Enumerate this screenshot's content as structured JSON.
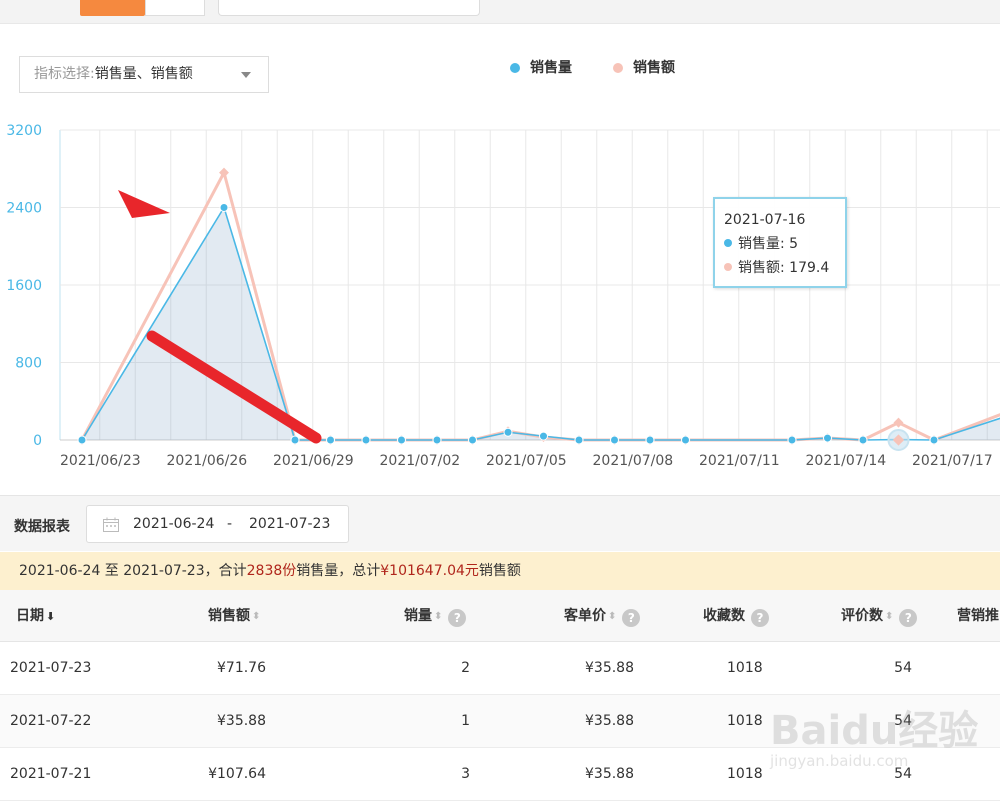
{
  "top_tabs": [
    "",
    ""
  ],
  "metric_select": {
    "label": "指标选择:",
    "value": "销售量、销售额"
  },
  "legend": [
    {
      "name": "销售量",
      "color": "#4ab8e6"
    },
    {
      "name": "销售额",
      "color": "#f7c3b8"
    }
  ],
  "chart_data": {
    "type": "area",
    "x": [
      "2021/06/23",
      "2021/06/24",
      "2021/06/25",
      "2021/06/26",
      "2021/06/27",
      "2021/06/28",
      "2021/06/29",
      "2021/06/30",
      "2021/07/01",
      "2021/07/02",
      "2021/07/03",
      "2021/07/04",
      "2021/07/05",
      "2021/07/06",
      "2021/07/07",
      "2021/07/08",
      "2021/07/09",
      "2021/07/10",
      "2021/07/11",
      "2021/07/12",
      "2021/07/13",
      "2021/07/14",
      "2021/07/15",
      "2021/07/16",
      "2021/07/17",
      "2021/07/18",
      "2021/07/19",
      "2021/07/20"
    ],
    "x_tick_labels": [
      "2021/06/23",
      "2021/06/26",
      "2021/06/29",
      "2021/07/02",
      "2021/07/05",
      "2021/07/08",
      "2021/07/11",
      "2021/07/14",
      "2021/07/17",
      "202"
    ],
    "series": [
      {
        "name": "销售量",
        "color": "#4ab8e6",
        "values": [
          0,
          null,
          null,
          null,
          2400,
          null,
          0,
          0,
          0,
          0,
          0,
          0,
          80,
          40,
          0,
          0,
          0,
          0,
          null,
          null,
          0,
          20,
          0,
          5,
          0,
          null,
          240,
          60
        ]
      },
      {
        "name": "销售额",
        "color": "#f7c3b8",
        "values": [
          0,
          null,
          null,
          null,
          2760,
          null,
          0,
          0,
          0,
          0,
          0,
          0,
          90,
          30,
          0,
          0,
          0,
          0,
          null,
          null,
          0,
          20,
          0,
          179.4,
          0,
          null,
          280,
          80
        ]
      }
    ],
    "y_ticks": [
      0,
      800,
      1600,
      2400,
      3200
    ],
    "ylim": [
      0,
      3200
    ],
    "grid": true,
    "legend_position": "top-center",
    "highlight_date": "2021/07/16"
  },
  "tooltip": {
    "date": "2021-07-16",
    "items": [
      {
        "name": "销售量",
        "value": "5",
        "color": "#4ab8e6"
      },
      {
        "name": "销售额",
        "value": "179.4",
        "color": "#f7c3b8"
      }
    ]
  },
  "report": {
    "title": "数据报表",
    "date_start": "2021-06-24",
    "date_sep": "-",
    "date_end": "2021-07-23"
  },
  "summary": {
    "prefix": "2021-06-24 至 2021-07-23，合计",
    "qty": "2838份",
    "mid": "销售量，总计",
    "amount": "¥101647.04元",
    "suffix": "销售额"
  },
  "table": {
    "columns": [
      "日期",
      "销售额",
      "销量",
      "客单价",
      "收藏数",
      "评价数",
      "营销推"
    ],
    "rows": [
      {
        "date": "2021-07-23",
        "sales": "¥71.76",
        "qty": "2",
        "unit_price": "¥35.88",
        "favorites": "1018",
        "reviews": "54"
      },
      {
        "date": "2021-07-22",
        "sales": "¥35.88",
        "qty": "1",
        "unit_price": "¥35.88",
        "favorites": "1018",
        "reviews": "54"
      },
      {
        "date": "2021-07-21",
        "sales": "¥107.64",
        "qty": "3",
        "unit_price": "¥35.88",
        "favorites": "1018",
        "reviews": "54"
      }
    ]
  },
  "watermark": {
    "text": "Baidu经验",
    "url": "jingyan.baidu.com"
  },
  "colors": {
    "accent": "#f5893f",
    "arrow": "#e8262b",
    "highlight": "#b0261c",
    "summary_bg": "#fdf0cf"
  }
}
